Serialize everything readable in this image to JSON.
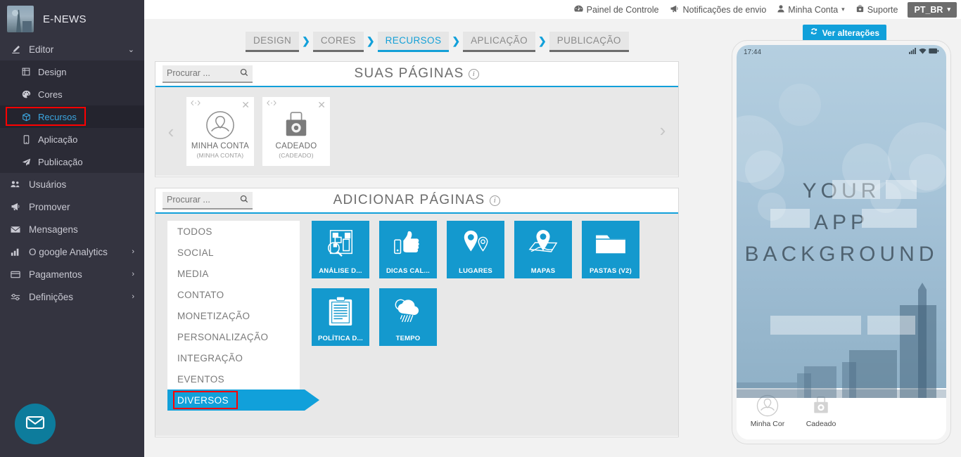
{
  "sidebar": {
    "brand": {
      "name": "E-NEWS",
      "logo_icon": "city-skyline-logo"
    },
    "items": [
      {
        "label": "Editor",
        "icon": "pencil-icon",
        "caret": "⌄",
        "expanded": true
      }
    ],
    "submenu": [
      {
        "label": "Design",
        "icon": "design-grid-icon",
        "active": false
      },
      {
        "label": "Cores",
        "icon": "palette-icon",
        "active": false
      },
      {
        "label": "Recursos",
        "icon": "box-icon",
        "active": true,
        "highlighted": true
      },
      {
        "label": "Aplicação",
        "icon": "mobile-icon",
        "active": false
      },
      {
        "label": "Publicação",
        "icon": "paper-plane-icon",
        "active": false
      }
    ],
    "items_bottom": [
      {
        "label": "Usuários",
        "icon": "users-icon",
        "caret": ""
      },
      {
        "label": "Promover",
        "icon": "megaphone-icon",
        "caret": ""
      },
      {
        "label": "Mensagens",
        "icon": "envelope-icon",
        "caret": ""
      },
      {
        "label": "O google Analytics",
        "icon": "bar-chart-icon",
        "caret": "›"
      },
      {
        "label": "Pagamentos",
        "icon": "credit-card-icon",
        "caret": "›"
      },
      {
        "label": "Definições",
        "icon": "sliders-icon",
        "caret": "›"
      }
    ],
    "fab": {
      "icon": "envelope-icon",
      "color": "#0d7c9c"
    }
  },
  "topbar": {
    "links": [
      {
        "label": "Painel de Controle",
        "icon": "dashboard-icon"
      },
      {
        "label": "Notificações de envio",
        "icon": "megaphone-icon"
      },
      {
        "label": "Minha Conta",
        "icon": "user-icon",
        "caret": "▾"
      },
      {
        "label": "Suporte",
        "icon": "lifebuoy-icon"
      }
    ],
    "language": {
      "label": "PT_BR",
      "caret": "▾"
    }
  },
  "workspace": {
    "changes_button": {
      "label": "Ver alterações",
      "icon": "refresh-icon",
      "color": "#11a0da"
    },
    "steps": [
      {
        "label": "DESIGN",
        "active": false
      },
      {
        "label": "CORES",
        "active": false
      },
      {
        "label": "RECURSOS",
        "active": true
      },
      {
        "label": "APLICAÇÃO",
        "active": false
      },
      {
        "label": "PUBLICAÇÃO",
        "active": false
      }
    ],
    "step_separator": "❯"
  },
  "your_pages": {
    "title": "SUAS PÁGINAS",
    "info_icon": "info-icon",
    "search": {
      "placeholder": "Procurar ...",
      "value": "",
      "icon": "search-icon"
    },
    "prev_arrow": "‹",
    "next_arrow": "›",
    "cards": [
      {
        "name": "MINHA CONTA",
        "sub": "(MINHA CONTA)",
        "icon": "user-circle-icon",
        "code_icon": "code-icon",
        "close_icon": "close-icon"
      },
      {
        "name": "CADEADO",
        "sub": "(CADEADO)",
        "icon": "padlock-icon",
        "code_icon": "code-icon",
        "close_icon": "close-icon"
      }
    ]
  },
  "add_pages": {
    "title": "ADICIONAR PÁGINAS",
    "info_icon": "info-icon",
    "search": {
      "placeholder": "Procurar ...",
      "value": "",
      "icon": "search-icon"
    },
    "categories": [
      {
        "label": "TODOS",
        "active": false
      },
      {
        "label": "SOCIAL",
        "active": false
      },
      {
        "label": "MEDIA",
        "active": false
      },
      {
        "label": "CONTATO",
        "active": false
      },
      {
        "label": "MONETIZAÇÃO",
        "active": false
      },
      {
        "label": "PERSONALIZAÇÃO",
        "active": false
      },
      {
        "label": "INTEGRAÇÃO",
        "active": false
      },
      {
        "label": "EVENTOS",
        "active": false
      },
      {
        "label": "DIVERSOS",
        "active": true,
        "highlighted": true
      }
    ],
    "tiles": [
      {
        "label": "ANÁLISE D...",
        "icon": "analysis-search-icon"
      },
      {
        "label": "DICAS CAL...",
        "icon": "thumbs-up-icon"
      },
      {
        "label": "LUGARES",
        "icon": "map-pins-icon"
      },
      {
        "label": "MAPAS",
        "icon": "map-pin-sheet-icon"
      },
      {
        "label": "PASTAS (V2)",
        "icon": "folder-icon"
      },
      {
        "label": "POLÍTICA D...",
        "icon": "clipboard-icon"
      },
      {
        "label": "TEMPO",
        "icon": "weather-rain-icon"
      }
    ],
    "tile_color": "#1499ce"
  },
  "phone_preview": {
    "status_time": "17:44",
    "status_icons": [
      "signal-icon",
      "wifi-icon",
      "battery-icon"
    ],
    "background_text": [
      "YOUR",
      "APP",
      "BACKGROUND"
    ],
    "nav": [
      {
        "label": "Minha Cor",
        "icon": "user-circle-icon"
      },
      {
        "label": "Cadeado",
        "icon": "padlock-icon"
      }
    ]
  }
}
